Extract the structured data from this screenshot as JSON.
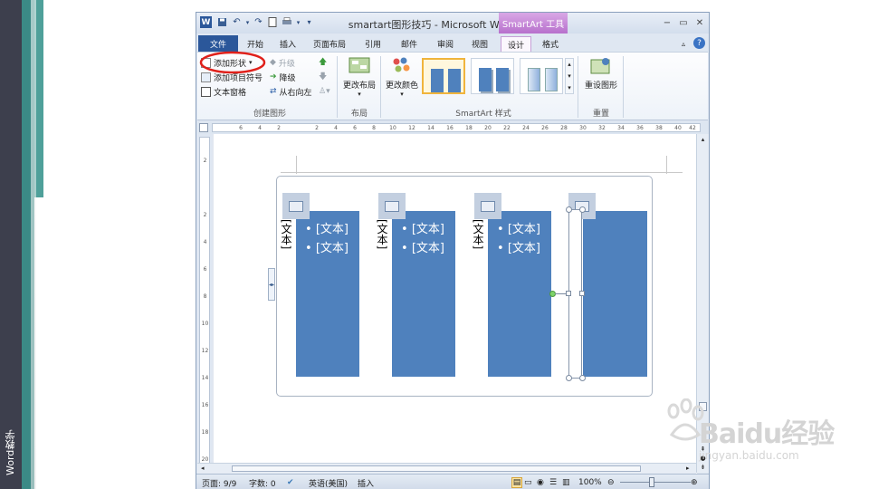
{
  "sidebar": {
    "label": "Word教学"
  },
  "window": {
    "title": "smartart图形技巧 - Microsoft Word",
    "contextual_tab": "SmartArt 工具",
    "controls": {
      "minimize": "−",
      "maximize": "▭",
      "close": "✕"
    },
    "quick_access": {
      "word_icon": "W",
      "undo": "↶",
      "redo": "↷"
    }
  },
  "tabs": [
    {
      "label": "文件"
    },
    {
      "label": "开始"
    },
    {
      "label": "插入"
    },
    {
      "label": "页面布局"
    },
    {
      "label": "引用"
    },
    {
      "label": "邮件"
    },
    {
      "label": "审阅"
    },
    {
      "label": "视图"
    },
    {
      "label": "设计"
    },
    {
      "label": "格式"
    }
  ],
  "ribbon": {
    "create": {
      "add_shape": "添加形状",
      "add_bullet": "添加项目符号",
      "text_pane": "文本窗格",
      "promote": "升级",
      "demote": "降级",
      "rtl": "从右向左",
      "group_label": "创建图形"
    },
    "layout": {
      "change_layout": "更改布局",
      "group_label": "布局"
    },
    "styles": {
      "change_colors": "更改颜色",
      "group_label": "SmartArt 样式"
    },
    "reset": {
      "reset_graphic": "重设图形",
      "group_label": "重置"
    }
  },
  "ruler": {
    "ticks": [
      "6",
      "4",
      "2",
      "",
      "2",
      "4",
      "6",
      "8",
      "10",
      "12",
      "14",
      "16",
      "18",
      "20",
      "22",
      "24",
      "26",
      "28",
      "30",
      "32",
      "34",
      "36",
      "38",
      "40",
      "42",
      "44"
    ]
  },
  "smartart": {
    "items": [
      {
        "label": "[文本]",
        "bullets": [
          "[文本]",
          "[文本]"
        ]
      },
      {
        "label": "[文本]",
        "bullets": [
          "[文本]",
          "[文本]"
        ]
      },
      {
        "label": "[文本]",
        "bullets": [
          "[文本]",
          "[文本]"
        ]
      },
      {
        "label": "",
        "bullets": []
      }
    ]
  },
  "statusbar": {
    "page": "页面: 9/9",
    "words": "字数: 0",
    "language": "英语(美国)",
    "mode": "插入",
    "zoom": "100%"
  },
  "watermark": {
    "text": "Baidu经验",
    "url": "jingyan.baidu.com"
  },
  "colors": {
    "accent_blue": "#4f81bd",
    "file_tab": "#2b579a",
    "smartart_purple": "#b770cc",
    "highlight_circle": "#e0201a"
  }
}
